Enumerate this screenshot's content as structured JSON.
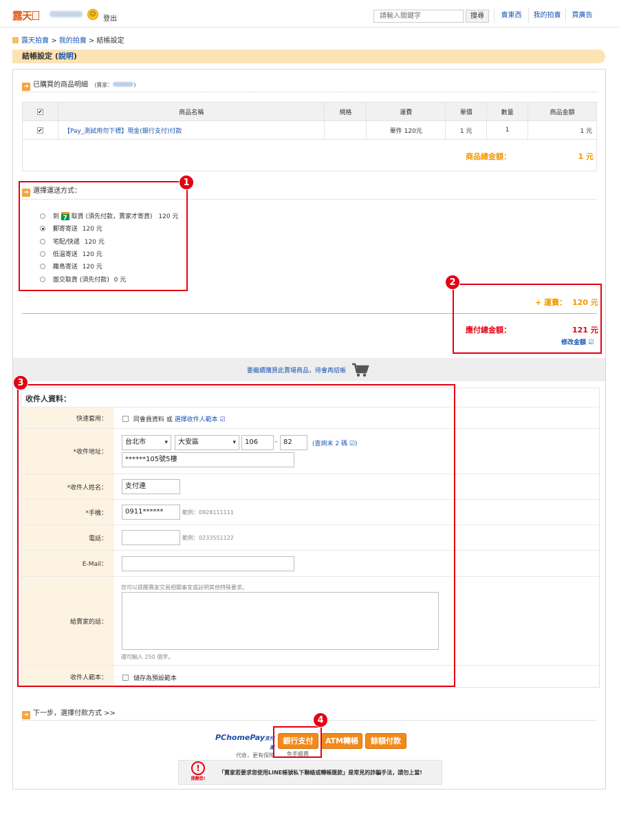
{
  "header": {
    "logo_text": "露天",
    "logout": "登出",
    "search_placeholder": "請輸入關鍵字",
    "search_button": "搜尋",
    "nav": [
      "賣東西",
      "我的拍賣",
      "買廣告"
    ]
  },
  "breadcrumb": {
    "items": [
      "露天拍賣",
      "我的拍賣",
      "結帳設定"
    ],
    "sep": ">"
  },
  "title": {
    "text": "結帳設定",
    "help_link": "說明"
  },
  "purchased": {
    "heading": "已購買的商品明細",
    "seller_prefix": "(賣家：",
    "seller_suffix": ")",
    "columns": [
      "商品名稱",
      "規格",
      "運費",
      "單價",
      "數量",
      "商品金額"
    ],
    "rows": [
      {
        "name": "【Pay_測試用勿下標】現金(銀行支付)付款",
        "spec": "",
        "shipping": "單件 120元",
        "price": "1 元",
        "qty": "1",
        "amount": "1 元"
      }
    ],
    "total_label": "商品總金額：",
    "total_value": "1 元"
  },
  "shipping": {
    "heading": "選擇運送方式：",
    "options": [
      {
        "pre": "到",
        "label": "取貨 (須先付款，賣家才寄貨)",
        "price": "120 元",
        "selected": false,
        "icon": "seven-eleven-icon"
      },
      {
        "label": "郵寄寄送",
        "price": "120 元",
        "selected": true
      },
      {
        "label": "宅配/快遞",
        "price": "120 元",
        "selected": false
      },
      {
        "label": "低溫寄送",
        "price": "120 元",
        "selected": false
      },
      {
        "label": "離島寄送",
        "price": "120 元",
        "selected": false
      },
      {
        "label": "面交取貨 (須先付款)",
        "price": "0 元",
        "selected": false
      }
    ]
  },
  "summary": {
    "shipping_label": "+ 運費：",
    "shipping_value": "120 元",
    "total_label": "應付總金額：",
    "total_value": "121 元",
    "modify_link": "修改金額"
  },
  "continue_text": "要繼續購買此賣場商品，待會再結帳",
  "recipient": {
    "heading": "收件人資料：",
    "quick_label": "快速套用：",
    "quick_text": "同會員資料 或",
    "quick_link": "選擇收件人範本",
    "address_label": "*收件地址：",
    "city": "台北市",
    "district": "大安區",
    "zip1": "106",
    "zip_sep": "-",
    "zip2": "82",
    "zip_lookup_pre": "(",
    "zip_lookup": "查詢末 2 碼",
    "zip_lookup_post": ")",
    "street": "******105號5樓",
    "name_label": "*收件人姓名：",
    "name_value": "支付連",
    "mobile_label": "*手機：",
    "mobile_value": "0911******",
    "mobile_hint": "範例：0928111111",
    "phone_label": "電話：",
    "phone_hint": "範例：0233551122",
    "email_label": "E-Mail：",
    "message_label": "給賣家的話：",
    "message_hint": "您可以提醒賣家交易相關事宜或註明其他特殊要求。",
    "message_remaining": "還可輸入 250 個字。",
    "template_label": "收件人範本：",
    "template_text": "儲存為預設範本"
  },
  "next_step": "下一步，選擇付款方式 >>",
  "payment": {
    "brand_name": "PChomePay",
    "brand_suffix": "支付連",
    "brand_tagline": "代收，更有保障",
    "buttons": [
      "銀行支付",
      "ATM轉帳",
      "餘額付款"
    ],
    "bank_note": "免手續費"
  },
  "warning": {
    "icon_caption": "提醒您!",
    "text": "「賣家若要求您使用LINE帳號私下聯絡或轉帳匯款」是常見的詐騙手法，請勿上當!"
  },
  "annotations": [
    "1",
    "2",
    "3",
    "4"
  ],
  "colors": {
    "accent_orange": "#f39800",
    "annotation_red": "#e60012",
    "link_blue": "#1a56b4"
  }
}
